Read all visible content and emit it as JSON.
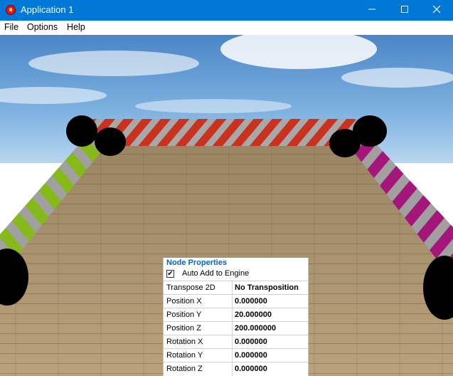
{
  "window": {
    "title": "Application 1",
    "minimize_icon": "minimize-icon",
    "maximize_icon": "maximize-icon",
    "close_icon": "close-icon"
  },
  "menu": [
    "File",
    "Options",
    "Help"
  ],
  "panel": {
    "title": "Node Properties",
    "auto_add_label": "Auto Add to Engine",
    "auto_add_checked": true,
    "rows": [
      {
        "name": "Transpose 2D",
        "value": "No Transposition"
      },
      {
        "name": "Position X",
        "value": "0.000000"
      },
      {
        "name": "Position Y",
        "value": "20.000000"
      },
      {
        "name": "Position Z",
        "value": "200.000000"
      },
      {
        "name": "Rotation X",
        "value": "0.000000"
      },
      {
        "name": "Rotation Y",
        "value": "0.000000"
      },
      {
        "name": "Rotation Z",
        "value": "0.000000"
      }
    ]
  },
  "colors": {
    "titlebar": "#0078d7",
    "back_tube": "#c8321e",
    "left_tube": "#86b91a",
    "right_tube": "#a5167a",
    "stripe": "#a0a0a0"
  }
}
